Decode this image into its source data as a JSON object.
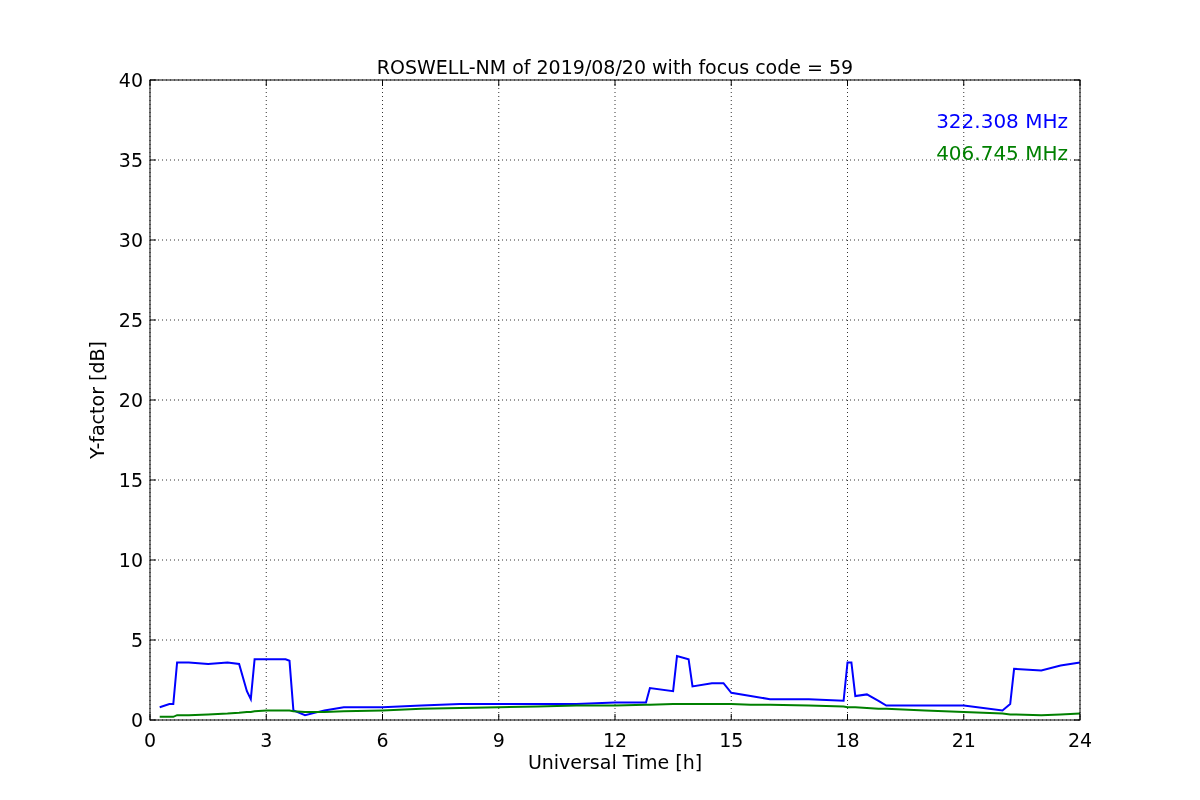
{
  "chart_data": {
    "type": "line",
    "title": "ROSWELL-NM of 2019/08/20 with focus code = 59",
    "xlabel": "Universal Time [h]",
    "ylabel": "Y-factor [dB]",
    "x": [
      0.25,
      0.5,
      0.6,
      0.7,
      1,
      1.5,
      2,
      2.3,
      2.5,
      2.6,
      2.7,
      3,
      3.5,
      3.6,
      3.7,
      4,
      4.5,
      5,
      6,
      7,
      8,
      9,
      10,
      11,
      12,
      12.8,
      12.9,
      13.5,
      13.6,
      13.9,
      14,
      14.5,
      14.8,
      15,
      15.5,
      16,
      17,
      17.9,
      18,
      18.1,
      18.2,
      18.5,
      18.8,
      19,
      20,
      21,
      22,
      22.2,
      22.3,
      23,
      23.5,
      24
    ],
    "series": [
      {
        "name": "322.308 MHz",
        "color": "#0000ff",
        "values": [
          0.8,
          1.0,
          1.0,
          3.6,
          3.6,
          3.5,
          3.6,
          3.5,
          1.8,
          1.3,
          3.8,
          3.8,
          3.8,
          3.7,
          0.6,
          0.3,
          0.6,
          0.8,
          0.8,
          0.9,
          1.0,
          1.0,
          1.0,
          1.0,
          1.1,
          1.1,
          2.0,
          1.8,
          4.0,
          3.8,
          2.1,
          2.3,
          2.3,
          1.7,
          1.5,
          1.3,
          1.3,
          1.2,
          3.6,
          3.6,
          1.5,
          1.6,
          1.2,
          0.9,
          0.9,
          0.9,
          0.6,
          1.0,
          3.2,
          3.1,
          3.4,
          3.6
        ]
      },
      {
        "name": "406.745 MHz",
        "color": "#008000",
        "values": [
          0.2,
          0.2,
          0.2,
          0.3,
          0.3,
          0.35,
          0.4,
          0.45,
          0.5,
          0.5,
          0.55,
          0.6,
          0.6,
          0.6,
          0.55,
          0.5,
          0.5,
          0.55,
          0.6,
          0.7,
          0.75,
          0.8,
          0.85,
          0.9,
          0.9,
          0.95,
          0.95,
          1.0,
          1.0,
          1.0,
          1.0,
          1.0,
          1.0,
          1.0,
          0.95,
          0.95,
          0.9,
          0.85,
          0.8,
          0.8,
          0.8,
          0.75,
          0.7,
          0.7,
          0.6,
          0.5,
          0.4,
          0.35,
          0.35,
          0.3,
          0.35,
          0.4
        ]
      }
    ],
    "xlim": [
      0,
      24
    ],
    "ylim": [
      0,
      40
    ],
    "xticks": [
      0,
      3,
      6,
      9,
      12,
      15,
      18,
      21,
      24
    ],
    "yticks": [
      0,
      5,
      10,
      15,
      20,
      25,
      30,
      35,
      40
    ],
    "grid": true
  }
}
